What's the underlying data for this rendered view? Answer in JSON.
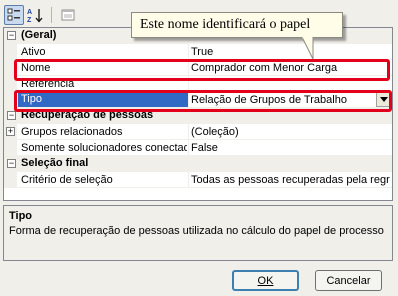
{
  "toolbar": {
    "categorized_icon": "categorized-icon",
    "alphabetical_icon": "sort-az-icon",
    "pages_icon": "property-pages-icon"
  },
  "callout": {
    "text": "Este nome identificará o papel"
  },
  "categories": [
    {
      "toggle": "⊟",
      "label": "(Geral)",
      "properties": [
        {
          "name": "Ativo",
          "value": "True"
        },
        {
          "name": "Nome",
          "value": "Comprador com Menor Carga"
        },
        {
          "name": "Referência",
          "value": ""
        },
        {
          "name": "Tipo",
          "value": "Relação de Grupos de Trabalho"
        }
      ]
    },
    {
      "toggle": "⊟",
      "label": "Recuperação de pessoas",
      "properties": [
        {
          "name": "Grupos relacionados",
          "value": "(Coleção)",
          "toggle": "+"
        },
        {
          "name": "Somente solucionadores conectados",
          "value": "False"
        }
      ]
    },
    {
      "toggle": "⊟",
      "label": "Seleção final",
      "properties": [
        {
          "name": "Critério de seleção",
          "value": "Todas as pessoas recuperadas pela regra"
        }
      ]
    }
  ],
  "description": {
    "title": "Tipo",
    "text": "Forma de recuperação de pessoas utilizada no cálculo do papel de processo"
  },
  "buttons": {
    "ok": "OK",
    "cancel": "Cancelar"
  },
  "colors": {
    "highlight": "#e3001b",
    "selection": "#316ac5"
  }
}
